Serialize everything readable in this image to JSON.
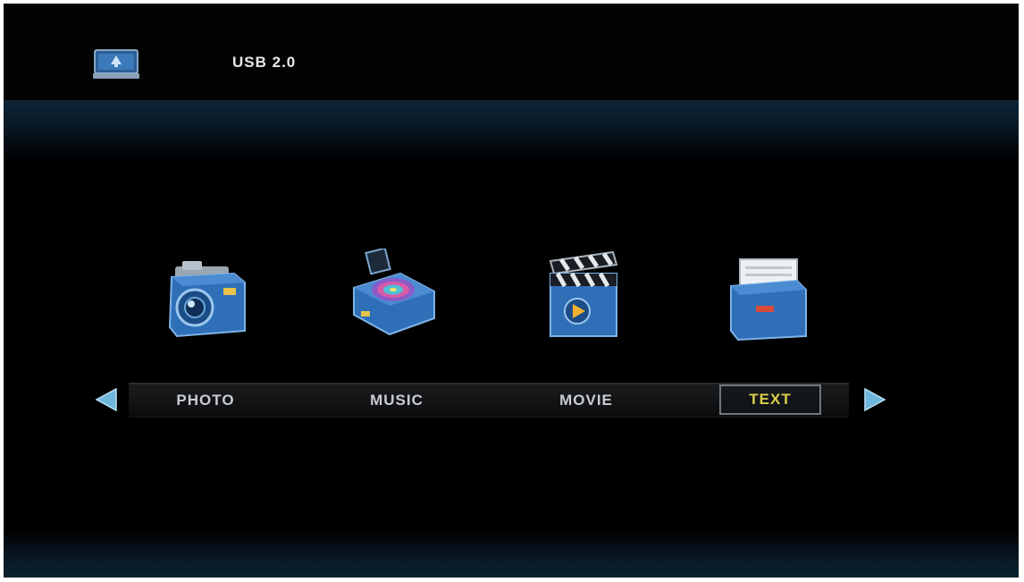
{
  "header": {
    "source_label": "USB 2.0",
    "source_icon": "usb-device-icon"
  },
  "menu": {
    "items": [
      {
        "label": "PHOTO",
        "icon": "camera-icon"
      },
      {
        "label": "MUSIC",
        "icon": "music-player-icon"
      },
      {
        "label": "MOVIE",
        "icon": "clapperboard-icon"
      },
      {
        "label": "TEXT",
        "icon": "folder-document-icon"
      }
    ],
    "selected_label": "TEXT",
    "nav_left_icon": "arrow-left-icon",
    "nav_right_icon": "arrow-right-icon"
  },
  "colors": {
    "background": "#000000",
    "label_text": "#c9ccd0",
    "selected_text": "#d8d04a",
    "icon_blue": "#2f6fb8",
    "arrow_blue": "#6fb6dc"
  }
}
